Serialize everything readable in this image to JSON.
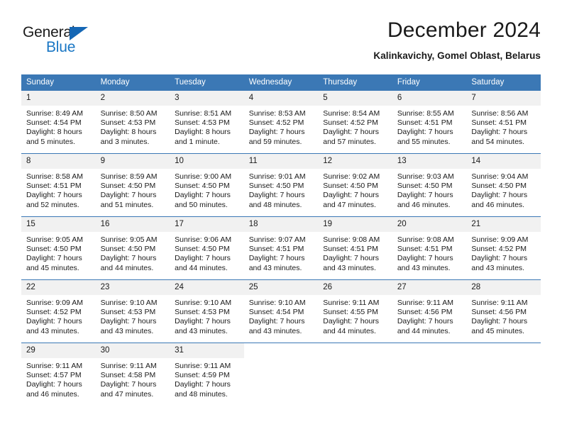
{
  "brand": {
    "name_part1": "General",
    "name_part2": "Blue",
    "triangle_color": "#1567b5",
    "blue_color": "#1976c4"
  },
  "header": {
    "title": "December 2024",
    "subtitle": "Kalinkavichy, Gomel Oblast, Belarus"
  },
  "theme": {
    "header_row_bg": "#3b78b5",
    "daynum_bg": "#f1f1f1",
    "grid_line": "#3b78b5"
  },
  "weekday_headers": [
    "Sunday",
    "Monday",
    "Tuesday",
    "Wednesday",
    "Thursday",
    "Friday",
    "Saturday"
  ],
  "weeks": [
    [
      {
        "day": "1",
        "sunrise": "Sunrise: 8:49 AM",
        "sunset": "Sunset: 4:54 PM",
        "daylight1": "Daylight: 8 hours",
        "daylight2": "and 5 minutes."
      },
      {
        "day": "2",
        "sunrise": "Sunrise: 8:50 AM",
        "sunset": "Sunset: 4:53 PM",
        "daylight1": "Daylight: 8 hours",
        "daylight2": "and 3 minutes."
      },
      {
        "day": "3",
        "sunrise": "Sunrise: 8:51 AM",
        "sunset": "Sunset: 4:53 PM",
        "daylight1": "Daylight: 8 hours",
        "daylight2": "and 1 minute."
      },
      {
        "day": "4",
        "sunrise": "Sunrise: 8:53 AM",
        "sunset": "Sunset: 4:52 PM",
        "daylight1": "Daylight: 7 hours",
        "daylight2": "and 59 minutes."
      },
      {
        "day": "5",
        "sunrise": "Sunrise: 8:54 AM",
        "sunset": "Sunset: 4:52 PM",
        "daylight1": "Daylight: 7 hours",
        "daylight2": "and 57 minutes."
      },
      {
        "day": "6",
        "sunrise": "Sunrise: 8:55 AM",
        "sunset": "Sunset: 4:51 PM",
        "daylight1": "Daylight: 7 hours",
        "daylight2": "and 55 minutes."
      },
      {
        "day": "7",
        "sunrise": "Sunrise: 8:56 AM",
        "sunset": "Sunset: 4:51 PM",
        "daylight1": "Daylight: 7 hours",
        "daylight2": "and 54 minutes."
      }
    ],
    [
      {
        "day": "8",
        "sunrise": "Sunrise: 8:58 AM",
        "sunset": "Sunset: 4:51 PM",
        "daylight1": "Daylight: 7 hours",
        "daylight2": "and 52 minutes."
      },
      {
        "day": "9",
        "sunrise": "Sunrise: 8:59 AM",
        "sunset": "Sunset: 4:50 PM",
        "daylight1": "Daylight: 7 hours",
        "daylight2": "and 51 minutes."
      },
      {
        "day": "10",
        "sunrise": "Sunrise: 9:00 AM",
        "sunset": "Sunset: 4:50 PM",
        "daylight1": "Daylight: 7 hours",
        "daylight2": "and 50 minutes."
      },
      {
        "day": "11",
        "sunrise": "Sunrise: 9:01 AM",
        "sunset": "Sunset: 4:50 PM",
        "daylight1": "Daylight: 7 hours",
        "daylight2": "and 48 minutes."
      },
      {
        "day": "12",
        "sunrise": "Sunrise: 9:02 AM",
        "sunset": "Sunset: 4:50 PM",
        "daylight1": "Daylight: 7 hours",
        "daylight2": "and 47 minutes."
      },
      {
        "day": "13",
        "sunrise": "Sunrise: 9:03 AM",
        "sunset": "Sunset: 4:50 PM",
        "daylight1": "Daylight: 7 hours",
        "daylight2": "and 46 minutes."
      },
      {
        "day": "14",
        "sunrise": "Sunrise: 9:04 AM",
        "sunset": "Sunset: 4:50 PM",
        "daylight1": "Daylight: 7 hours",
        "daylight2": "and 46 minutes."
      }
    ],
    [
      {
        "day": "15",
        "sunrise": "Sunrise: 9:05 AM",
        "sunset": "Sunset: 4:50 PM",
        "daylight1": "Daylight: 7 hours",
        "daylight2": "and 45 minutes."
      },
      {
        "day": "16",
        "sunrise": "Sunrise: 9:05 AM",
        "sunset": "Sunset: 4:50 PM",
        "daylight1": "Daylight: 7 hours",
        "daylight2": "and 44 minutes."
      },
      {
        "day": "17",
        "sunrise": "Sunrise: 9:06 AM",
        "sunset": "Sunset: 4:50 PM",
        "daylight1": "Daylight: 7 hours",
        "daylight2": "and 44 minutes."
      },
      {
        "day": "18",
        "sunrise": "Sunrise: 9:07 AM",
        "sunset": "Sunset: 4:51 PM",
        "daylight1": "Daylight: 7 hours",
        "daylight2": "and 43 minutes."
      },
      {
        "day": "19",
        "sunrise": "Sunrise: 9:08 AM",
        "sunset": "Sunset: 4:51 PM",
        "daylight1": "Daylight: 7 hours",
        "daylight2": "and 43 minutes."
      },
      {
        "day": "20",
        "sunrise": "Sunrise: 9:08 AM",
        "sunset": "Sunset: 4:51 PM",
        "daylight1": "Daylight: 7 hours",
        "daylight2": "and 43 minutes."
      },
      {
        "day": "21",
        "sunrise": "Sunrise: 9:09 AM",
        "sunset": "Sunset: 4:52 PM",
        "daylight1": "Daylight: 7 hours",
        "daylight2": "and 43 minutes."
      }
    ],
    [
      {
        "day": "22",
        "sunrise": "Sunrise: 9:09 AM",
        "sunset": "Sunset: 4:52 PM",
        "daylight1": "Daylight: 7 hours",
        "daylight2": "and 43 minutes."
      },
      {
        "day": "23",
        "sunrise": "Sunrise: 9:10 AM",
        "sunset": "Sunset: 4:53 PM",
        "daylight1": "Daylight: 7 hours",
        "daylight2": "and 43 minutes."
      },
      {
        "day": "24",
        "sunrise": "Sunrise: 9:10 AM",
        "sunset": "Sunset: 4:53 PM",
        "daylight1": "Daylight: 7 hours",
        "daylight2": "and 43 minutes."
      },
      {
        "day": "25",
        "sunrise": "Sunrise: 9:10 AM",
        "sunset": "Sunset: 4:54 PM",
        "daylight1": "Daylight: 7 hours",
        "daylight2": "and 43 minutes."
      },
      {
        "day": "26",
        "sunrise": "Sunrise: 9:11 AM",
        "sunset": "Sunset: 4:55 PM",
        "daylight1": "Daylight: 7 hours",
        "daylight2": "and 44 minutes."
      },
      {
        "day": "27",
        "sunrise": "Sunrise: 9:11 AM",
        "sunset": "Sunset: 4:56 PM",
        "daylight1": "Daylight: 7 hours",
        "daylight2": "and 44 minutes."
      },
      {
        "day": "28",
        "sunrise": "Sunrise: 9:11 AM",
        "sunset": "Sunset: 4:56 PM",
        "daylight1": "Daylight: 7 hours",
        "daylight2": "and 45 minutes."
      }
    ],
    [
      {
        "day": "29",
        "sunrise": "Sunrise: 9:11 AM",
        "sunset": "Sunset: 4:57 PM",
        "daylight1": "Daylight: 7 hours",
        "daylight2": "and 46 minutes."
      },
      {
        "day": "30",
        "sunrise": "Sunrise: 9:11 AM",
        "sunset": "Sunset: 4:58 PM",
        "daylight1": "Daylight: 7 hours",
        "daylight2": "and 47 minutes."
      },
      {
        "day": "31",
        "sunrise": "Sunrise: 9:11 AM",
        "sunset": "Sunset: 4:59 PM",
        "daylight1": "Daylight: 7 hours",
        "daylight2": "and 48 minutes."
      },
      {
        "day": "",
        "sunrise": "",
        "sunset": "",
        "daylight1": "",
        "daylight2": ""
      },
      {
        "day": "",
        "sunrise": "",
        "sunset": "",
        "daylight1": "",
        "daylight2": ""
      },
      {
        "day": "",
        "sunrise": "",
        "sunset": "",
        "daylight1": "",
        "daylight2": ""
      },
      {
        "day": "",
        "sunrise": "",
        "sunset": "",
        "daylight1": "",
        "daylight2": ""
      }
    ]
  ]
}
